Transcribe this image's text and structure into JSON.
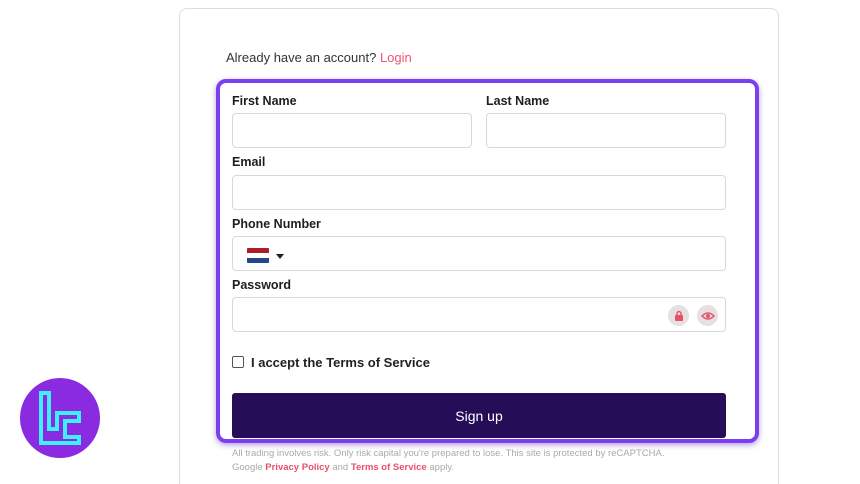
{
  "header": {
    "already_text": "Already have an account?",
    "login_link": "Login"
  },
  "form": {
    "first_name_label": "First Name",
    "last_name_label": "Last Name",
    "email_label": "Email",
    "phone_label": "Phone Number",
    "password_label": "Password",
    "terms_label": "I accept the Terms of Service",
    "submit_label": "Sign up",
    "phone_country_flag": "netherlands-flag-icon"
  },
  "disclaimer": {
    "line1": "All trading involves risk. Only risk capital you're prepared to lose. This site is protected by reCAPTCHA.",
    "google": "Google",
    "privacy_policy": "Privacy Policy",
    "and": "and",
    "terms_of_service": "Terms of Service",
    "apply": "apply."
  },
  "colors": {
    "accent_link": "#f0566f",
    "button": "#260d57",
    "highlight": "#7a3ff0",
    "logo_bg": "#8a2be2",
    "logo_fg": "#3ef0ff"
  }
}
